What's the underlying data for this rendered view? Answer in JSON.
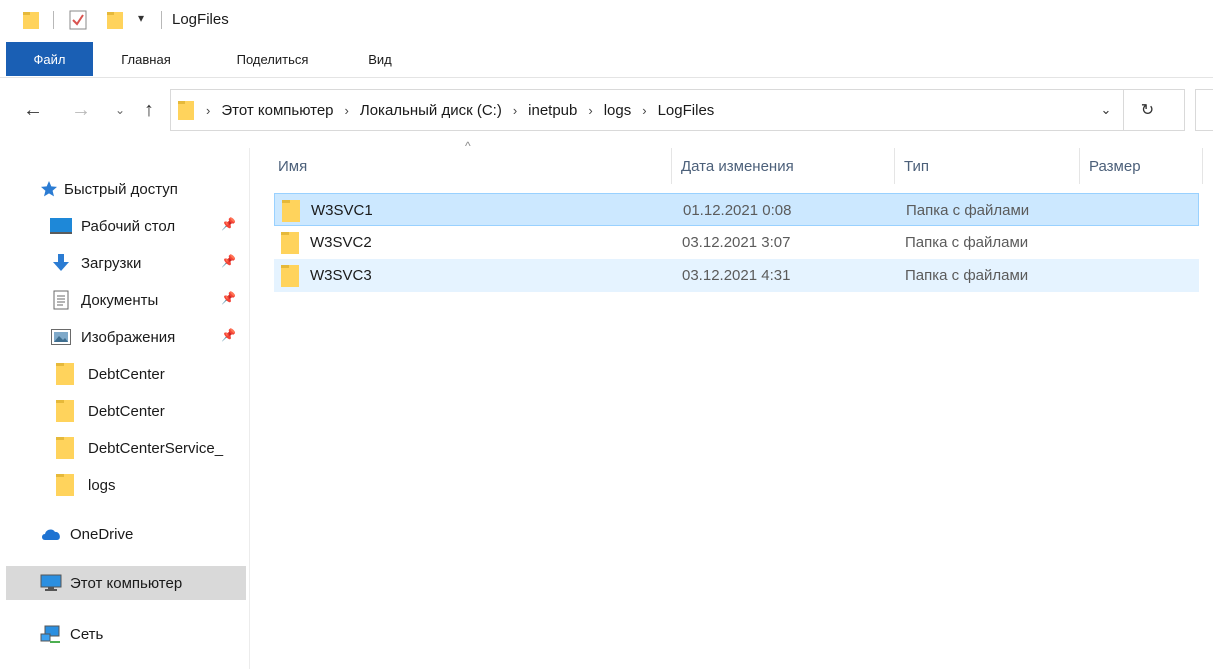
{
  "window": {
    "title": "LogFiles",
    "quick_access_toolbar": [
      "folder-icon",
      "properties-check-icon",
      "new-folder-icon",
      "customize-dropdown-icon"
    ]
  },
  "ribbon": {
    "tabs": [
      {
        "label": "Файл",
        "active": true
      },
      {
        "label": "Главная"
      },
      {
        "label": "Поделиться"
      },
      {
        "label": "Вид"
      }
    ]
  },
  "navigation": {
    "back": "←",
    "forward": "→",
    "recent": "⌄",
    "up": "↑"
  },
  "address": {
    "breadcrumbs": [
      "Этот компьютер",
      "Локальный диск (C:)",
      "inetpub",
      "logs",
      "LogFiles"
    ],
    "dropdown": "⌄",
    "refresh": "↻"
  },
  "sidebar": {
    "items": [
      {
        "label": "Быстрый доступ",
        "icon": "star-icon"
      },
      {
        "label": "Рабочий стол",
        "icon": "desktop-icon",
        "pinned": true
      },
      {
        "label": "Загрузки",
        "icon": "download-icon",
        "pinned": true
      },
      {
        "label": "Документы",
        "icon": "documents-icon",
        "pinned": true
      },
      {
        "label": "Изображения",
        "icon": "pictures-icon",
        "pinned": true
      },
      {
        "label": "DebtCenter",
        "icon": "folder-icon"
      },
      {
        "label": "DebtCenter",
        "icon": "folder-icon"
      },
      {
        "label": "DebtCenterService_",
        "icon": "folder-icon"
      },
      {
        "label": "logs",
        "icon": "folder-icon"
      },
      {
        "label": "OneDrive",
        "icon": "cloud-icon"
      },
      {
        "label": "Этот компьютер",
        "icon": "computer-icon",
        "selected": true
      },
      {
        "label": "Сеть",
        "icon": "network-icon"
      }
    ]
  },
  "file_list": {
    "columns": [
      "Имя",
      "Дата изменения",
      "Тип",
      "Размер"
    ],
    "sort_indicator": "^",
    "rows": [
      {
        "name": "W3SVC1",
        "modified": "01.12.2021 0:08",
        "type": "Папка с файлами",
        "size": "",
        "state": "selected"
      },
      {
        "name": "W3SVC2",
        "modified": "03.12.2021 3:07",
        "type": "Папка с файлами",
        "size": "",
        "state": "normal"
      },
      {
        "name": "W3SVC3",
        "modified": "03.12.2021 4:31",
        "type": "Папка с файлами",
        "size": "",
        "state": "hover"
      }
    ]
  },
  "colors": {
    "file_tab": "#1a5fb4",
    "selected_row": "#cce8ff",
    "hover_row": "#e5f3ff",
    "folder": "#ffd35c",
    "sidebar_selected": "#d9d9d9"
  }
}
